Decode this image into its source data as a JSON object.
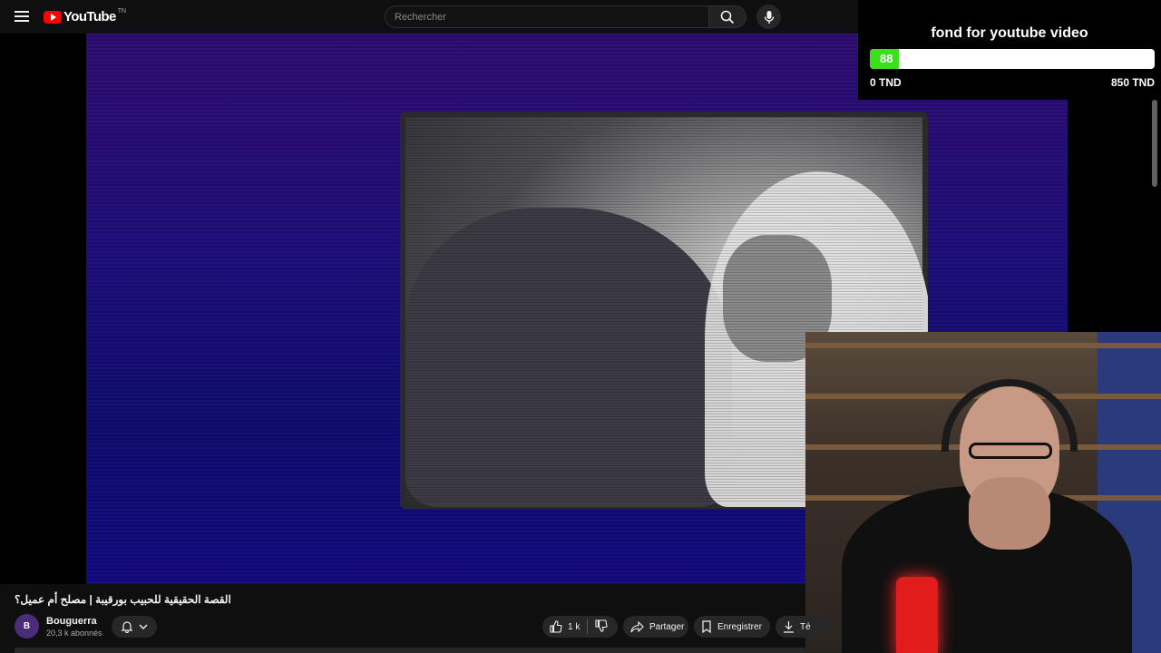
{
  "header": {
    "logo_text": "YouTube",
    "logo_country": "TN",
    "search_placeholder": "Rechercher"
  },
  "donation": {
    "title": "fond for youtube video",
    "current_value": "88",
    "progress_fraction": 0.1035,
    "min_label": "0 TND",
    "max_label": "850 TND",
    "fill_color": "#39e01b"
  },
  "video": {
    "title": "القصة الحقيقية للحبيب بورقيبة | مصلح أم عميل؟",
    "channel_name": "Bouguerra",
    "channel_avatar_text": "B",
    "subscribers": "20,3 k abonnés",
    "likes": "1 k",
    "share_label": "Partager",
    "save_label": "Enregistrer",
    "download_label": "Té"
  },
  "icons": {
    "menu": "menu-icon",
    "search": "search-icon",
    "mic": "mic-icon",
    "bell": "bell-icon",
    "like": "thumbs-up-icon",
    "dislike": "thumbs-down-icon",
    "share": "share-icon",
    "save": "bookmark-icon",
    "download": "download-icon"
  }
}
